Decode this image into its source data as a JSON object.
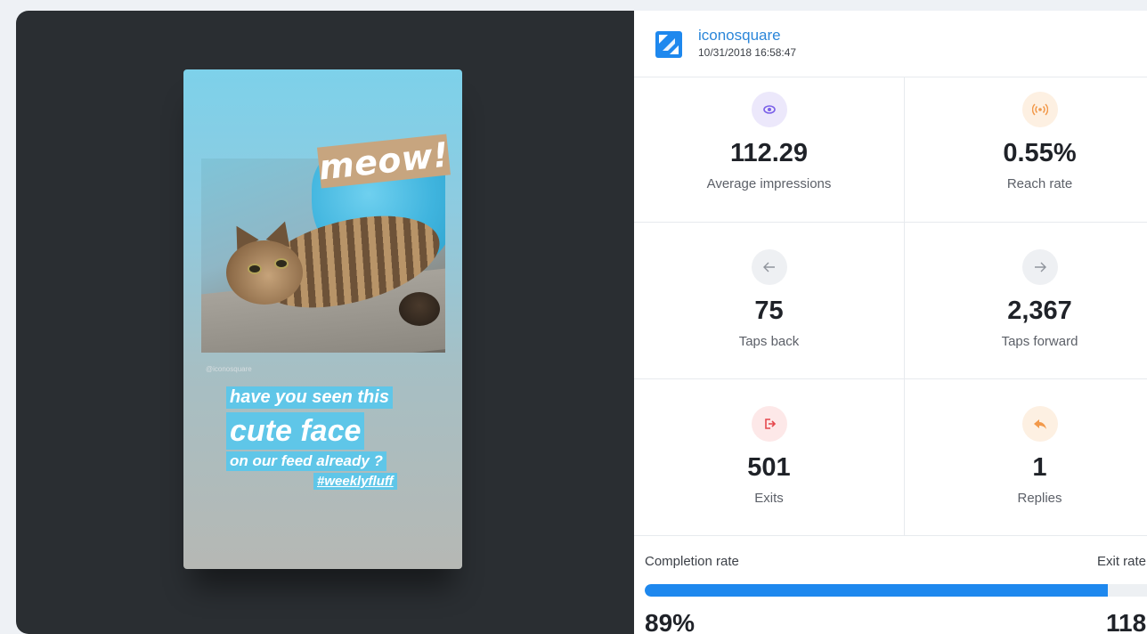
{
  "story": {
    "sticker": "meow!",
    "handle": "@iconosquare",
    "caption_lines": [
      "have you seen this",
      "cute face",
      "on our feed already ?",
      "#weeklyfluff"
    ]
  },
  "account": {
    "name": "iconosquare",
    "date": "10/31/2018 16:58:47",
    "logo_icon": "iconosquare-logo-icon"
  },
  "stats": [
    {
      "value": "112.29",
      "label": "Average impressions",
      "icon": "eye-icon",
      "color": "#7b61e8"
    },
    {
      "value": "0.55%",
      "label": "Reach rate",
      "icon": "broadcast-icon",
      "color": "#f2994a"
    },
    {
      "value": "75",
      "label": "Taps back",
      "icon": "arrow-left-icon",
      "color": "#8f949c"
    },
    {
      "value": "2,367",
      "label": "Taps forward",
      "icon": "arrow-right-icon",
      "color": "#8f949c"
    },
    {
      "value": "501",
      "label": "Exits",
      "icon": "exit-icon",
      "color": "#e5484d"
    },
    {
      "value": "1",
      "label": "Replies",
      "icon": "reply-icon",
      "color": "#f2994a"
    }
  ],
  "completion": {
    "label": "Completion rate",
    "value": "89%",
    "fill_fraction": 0.89,
    "exit_label": "Exit rate",
    "exit_value": "118"
  },
  "colors": {
    "accent": "#1e88ee",
    "left_background": "#2a2e32",
    "account_name": "#2b86d9"
  }
}
